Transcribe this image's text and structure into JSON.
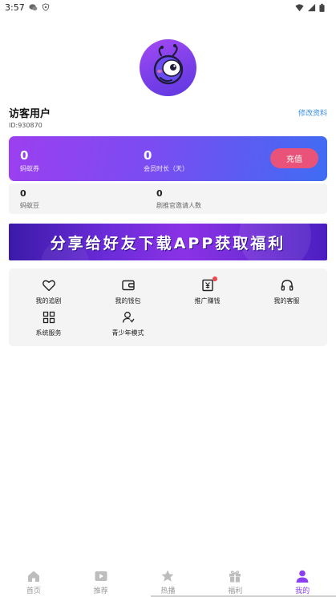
{
  "status_bar": {
    "time": "3:57",
    "icons_left": [
      "chat-bubble-icon",
      "shield-icon"
    ],
    "icons_right": [
      "wifi-icon",
      "signal-icon",
      "battery-icon"
    ]
  },
  "profile": {
    "avatar": "ant-mascot-avatar",
    "name": "访客用户",
    "id_text": "ID:930870",
    "edit_label": "修改资料"
  },
  "vip_card": {
    "coupon_count": "0",
    "coupon_label": "蚂蚁券",
    "vip_duration": "0",
    "vip_duration_label": "会员时长（天）",
    "recharge_label": "充值"
  },
  "stats": {
    "beans_count": "0",
    "beans_label": "蚂蚁豆",
    "invite_count": "0",
    "invite_label": "剧推官邀请人数"
  },
  "banner": {
    "text": "分享给好友下载APP获取福利"
  },
  "menu": {
    "items": [
      {
        "label": "我的追剧",
        "icon": "heart-icon"
      },
      {
        "label": "我的钱包",
        "icon": "wallet-icon"
      },
      {
        "label": "推广赚钱",
        "icon": "yuan-icon"
      },
      {
        "label": "我的客服",
        "icon": "headphones-icon"
      },
      {
        "label": "系统服务",
        "icon": "grid-icon"
      },
      {
        "label": "青少年模式",
        "icon": "user-shield-icon"
      }
    ]
  },
  "bottom_nav": {
    "items": [
      {
        "label": "首页",
        "icon": "home-icon"
      },
      {
        "label": "推荐",
        "icon": "play-icon"
      },
      {
        "label": "热播",
        "icon": "star-icon"
      },
      {
        "label": "福利",
        "icon": "gift-icon"
      },
      {
        "label": "我的",
        "icon": "person-icon"
      }
    ],
    "active_index": 4
  },
  "colors": {
    "accent": "#8a3ff0",
    "recharge_button": "#e9537a",
    "link": "#3a8ee8",
    "inactive_nav": "#999999"
  }
}
